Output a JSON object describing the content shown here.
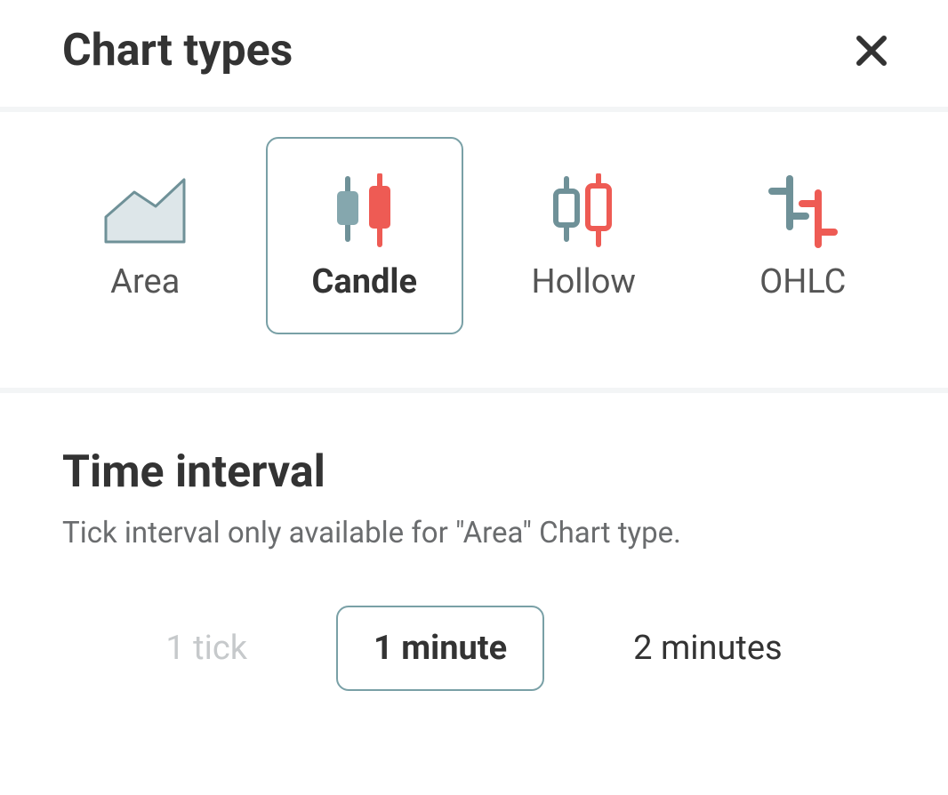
{
  "header": {
    "title": "Chart types"
  },
  "chartTypes": {
    "items": [
      {
        "label": "Area",
        "selected": false
      },
      {
        "label": "Candle",
        "selected": true
      },
      {
        "label": "Hollow",
        "selected": false
      },
      {
        "label": "OHLC",
        "selected": false
      }
    ]
  },
  "timeInterval": {
    "title": "Time interval",
    "help": "Tick interval only available for \"Area\" Chart type.",
    "options": [
      {
        "label": "1 tick",
        "state": "disabled"
      },
      {
        "label": "1 minute",
        "state": "selected"
      },
      {
        "label": "2 minutes",
        "state": "normal"
      }
    ]
  },
  "colors": {
    "teal": "#85a7ae",
    "tealDark": "#6f9198",
    "red": "#ee5b54"
  }
}
